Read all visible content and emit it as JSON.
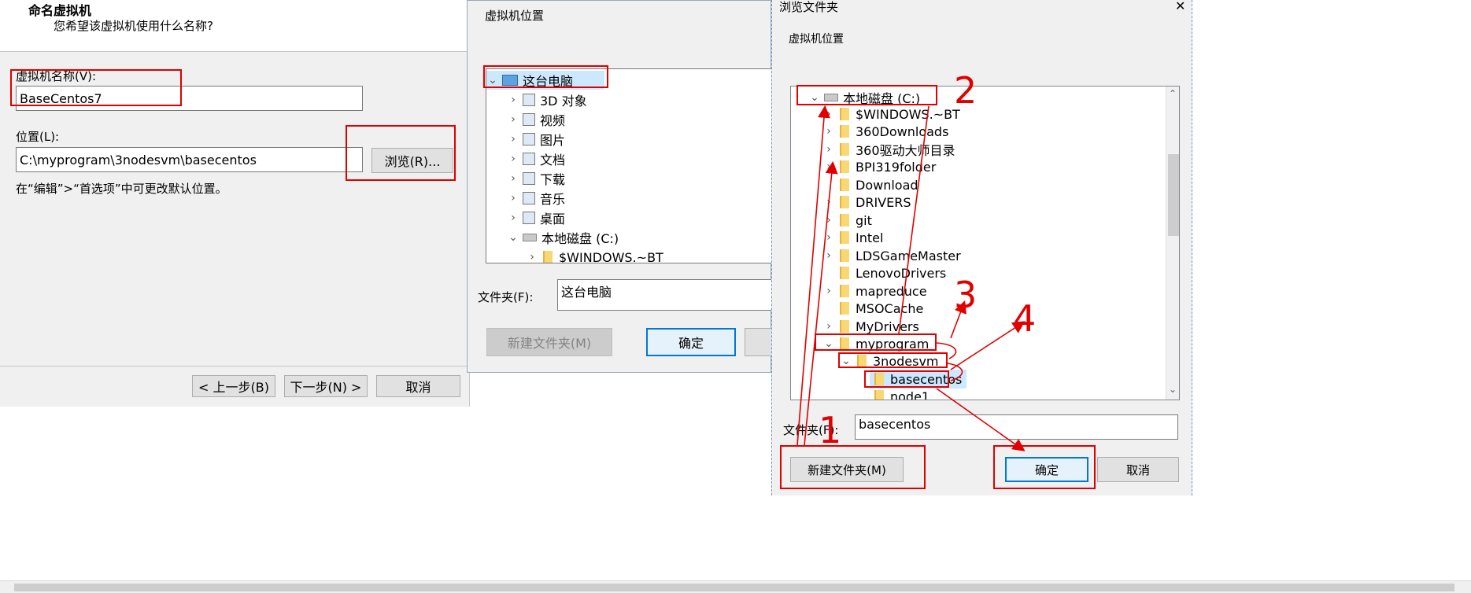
{
  "wizard": {
    "title": "命名虚拟机",
    "subtitle": "您希望该虚拟机使用什么名称?",
    "name_label": "虚拟机名称(V):",
    "name_value": "BaseCentos7",
    "location_label": "位置(L):",
    "location_value": "C:\\myprogram\\3nodesvm\\basecentos",
    "browse_label": "浏览(R)...",
    "hint": "在“编辑”>“首选项”中可更改默认位置。",
    "back_label": "< 上一步(B)",
    "next_label": "下一步(N) >",
    "cancel_label": "取消"
  },
  "browse_dialog_1": {
    "header": "虚拟机位置",
    "tree": [
      {
        "label": "这台电脑",
        "icon": "computer-icon",
        "expanded": true,
        "selected": true
      },
      {
        "label": "3D 对象",
        "icon": "3d-objects-icon"
      },
      {
        "label": "视频",
        "icon": "video-icon"
      },
      {
        "label": "图片",
        "icon": "pictures-icon"
      },
      {
        "label": "文档",
        "icon": "documents-icon"
      },
      {
        "label": "下载",
        "icon": "download-icon"
      },
      {
        "label": "音乐",
        "icon": "music-icon"
      },
      {
        "label": "桌面",
        "icon": "desktop-icon"
      },
      {
        "label": "本地磁盘 (C:)",
        "icon": "drive-icon",
        "expanded": true
      },
      {
        "label": "$WINDOWS.~BT",
        "icon": "folder-icon"
      }
    ],
    "folder_label": "文件夹(F):",
    "folder_value": "这台电脑",
    "new_folder_label": "新建文件夹(M)",
    "ok_label": "确定"
  },
  "browse_dialog_2": {
    "title": "浏览文件夹",
    "close_glyph": "✕",
    "header": "虚拟机位置",
    "tree": [
      {
        "label": "本地磁盘 (C:)",
        "icon": "drive-icon",
        "expanded": true
      },
      {
        "label": "$WINDOWS.~BT",
        "icon": "folder-icon"
      },
      {
        "label": "360Downloads",
        "icon": "folder-icon"
      },
      {
        "label": "360驱动大师目录",
        "icon": "folder-icon"
      },
      {
        "label": "BPI319folder",
        "icon": "folder-icon"
      },
      {
        "label": "Download",
        "icon": "folder-icon"
      },
      {
        "label": "DRIVERS",
        "icon": "folder-icon"
      },
      {
        "label": "git",
        "icon": "folder-icon"
      },
      {
        "label": "Intel",
        "icon": "folder-icon"
      },
      {
        "label": "LDSGameMaster",
        "icon": "folder-icon"
      },
      {
        "label": "LenovoDrivers",
        "icon": "folder-icon"
      },
      {
        "label": "mapreduce",
        "icon": "folder-icon"
      },
      {
        "label": "MSOCache",
        "icon": "folder-icon"
      },
      {
        "label": "MyDrivers",
        "icon": "folder-icon"
      },
      {
        "label": "myprogram",
        "icon": "folder-icon",
        "expanded": true
      },
      {
        "label": "3nodesvm",
        "icon": "folder-icon",
        "expanded": true
      },
      {
        "label": "basecentos",
        "icon": "folder-icon",
        "selected": true
      },
      {
        "label": "node1",
        "icon": "folder-icon"
      }
    ],
    "folder_label": "文件夹(F):",
    "folder_value": "basecentos",
    "new_folder_label": "新建文件夹(M)",
    "ok_label": "确定",
    "cancel_label": "取消"
  },
  "annotations": [
    "1",
    "2",
    "3",
    "4"
  ],
  "colors": {
    "annotation": "#e00000",
    "selection": "#cce8ff",
    "accent": "#0078d7"
  }
}
